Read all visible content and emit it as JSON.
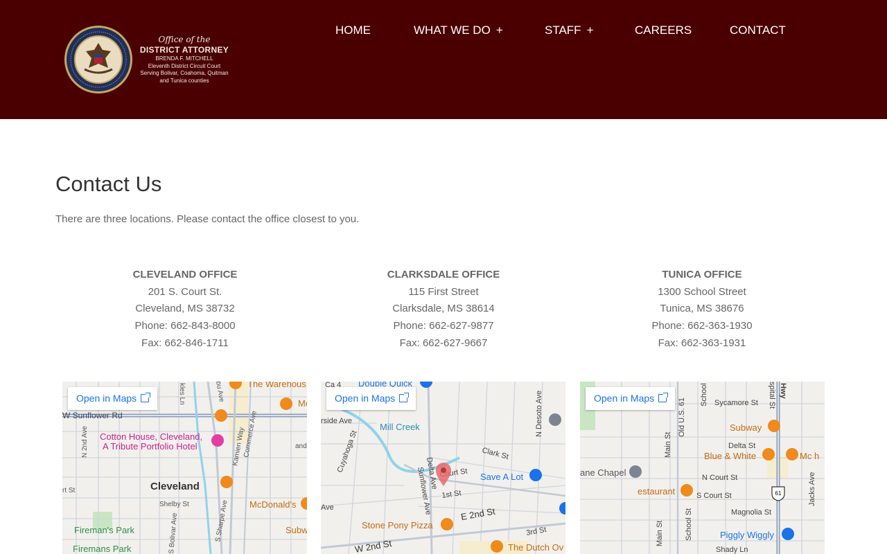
{
  "logo": {
    "line1": "Office of the",
    "line2": "DISTRICT ATTORNEY",
    "line3": "BRENDA F. MITCHELL",
    "line4": "Eleventh District Circuit Court",
    "line5": "Serving Bolivar, Coahoma, Quitman",
    "line6": "and Tunica counties",
    "seal_text": "THE GREAT SEAL OF THE STATE OF MISSISSIPPI · IN GOD WE TRUST"
  },
  "nav": {
    "home": "HOME",
    "what_we_do": "WHAT WE DO",
    "staff": "STAFF",
    "careers": "CAREERS",
    "contact": "CONTACT",
    "plus": "+"
  },
  "main": {
    "title": "Contact Us",
    "intro": "There are three locations. Please contact the office closest to you."
  },
  "offices": [
    {
      "name": "CLEVELAND OFFICE",
      "street": "201 S. Court St.",
      "city": "Cleveland, MS 38732",
      "phone": "Phone: 662-843-8000",
      "fax": "Fax: 662-846-1711"
    },
    {
      "name": "CLARKSDALE OFFICE",
      "street": "115 First Street",
      "city": "Clarksdale, MS 38614",
      "phone": "Phone: 662-627-9877",
      "fax": "Fax: 662-627-9667"
    },
    {
      "name": "TUNICA OFFICE",
      "street": "1300 School Street",
      "city": "Tunica, MS 38676",
      "phone": "Phone: 662-363-1930",
      "fax": "Fax: 662-363-1931"
    }
  ],
  "maps": [
    {
      "open_label": "Open in Maps",
      "labels": {
        "warehouse": "The Warehous",
        "sunflower_rd": "W Sunflower Rd",
        "cotton_house_1": "Cotton House, Cleveland,",
        "cotton_house_2": "A Tribute Portfolio Hotel",
        "cleveland": "Cleveland",
        "mcdonalds": "McDonald's",
        "subway": "Subw",
        "firemans_park_1": "Fireman's Park",
        "firemans_park_2": "Firemans Park",
        "shelby": "Shelby St",
        "n2nd": "N 2nd Ave",
        "kamien": "Kamien Way",
        "commerce": "Commerce Ave",
        "s_sharpe": "S Sharpe Ave",
        "s_bolivar": "S Bolivar Ave",
        "ave": "and",
        "rt_st": "rt St",
        "kles": "kles Ln",
        "bu_ave": "bu Ave",
        "mc": "Mc"
      }
    },
    {
      "open_label": "Open in Maps",
      "labels": {
        "double_quick": "Double Quick",
        "mill_creek": "Mill Creek",
        "clark": "Clark St",
        "save_a_lot": "Save A Lot",
        "court": "Court St",
        "first": "1st St",
        "e2nd": "E 2nd St",
        "stone_pony": "Stone Pony Pizza",
        "w2nd": "W 2nd St",
        "dutch": "The Dutch Ov",
        "third": "3rd St",
        "delta": "Delta Ave",
        "sunflower": "Sunflower Ave",
        "cuyahoga": "Cuyahoga St",
        "desoto": "N Desoto Ave",
        "riverside": "rside Ave",
        "ave": "Ave",
        "ca": "Ca 4"
      }
    },
    {
      "open_label": "Open in Maps",
      "labels": {
        "sycamore": "Sycamore St",
        "subway": "Subway",
        "delta": "Delta St",
        "blue_white": "Blue & White",
        "mch": "Mc h",
        "chapel": "ane Chapel",
        "n_court": "N Court St",
        "restaurant": "estaurant",
        "s_court": "S Court St",
        "magnolia": "Magnolia St",
        "piggly": "Piggly Wiggly",
        "shady": "Shady Ln",
        "main": "Main St",
        "old61": "Old U.S. 61",
        "school": "School St",
        "jacks": "Jacks Ave",
        "hospital": "spital St",
        "school_n": "School",
        "hwy": "Hwy",
        "us61": "61"
      }
    }
  ]
}
